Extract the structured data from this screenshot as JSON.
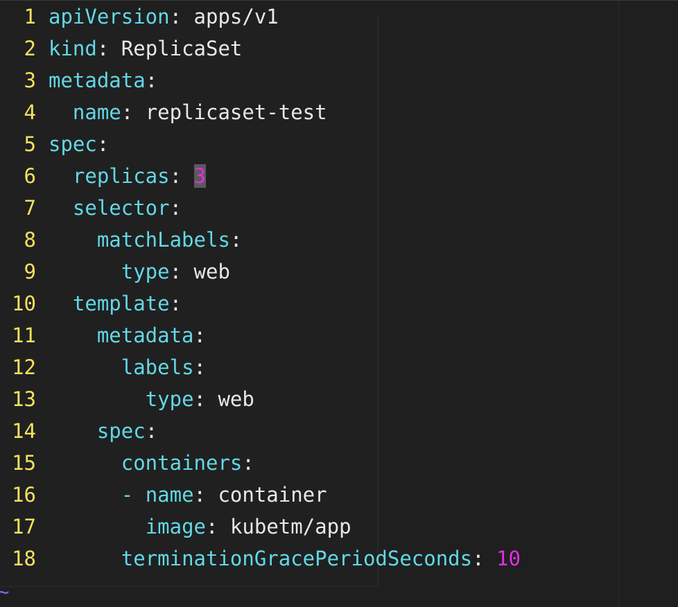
{
  "editor": {
    "lines": [
      {
        "n": "1",
        "indent": "",
        "dash": "",
        "key": "apiVersion",
        "value": "apps/v1",
        "value_type": "string"
      },
      {
        "n": "2",
        "indent": "",
        "dash": "",
        "key": "kind",
        "value": "ReplicaSet",
        "value_type": "string"
      },
      {
        "n": "3",
        "indent": "",
        "dash": "",
        "key": "metadata",
        "value": "",
        "value_type": "string"
      },
      {
        "n": "4",
        "indent": "  ",
        "dash": "",
        "key": "name",
        "value": "replicaset-test",
        "value_type": "string"
      },
      {
        "n": "5",
        "indent": "",
        "dash": "",
        "key": "spec",
        "value": "",
        "value_type": "string"
      },
      {
        "n": "6",
        "indent": "  ",
        "dash": "",
        "key": "replicas",
        "value": "3",
        "value_type": "number",
        "cursor": true
      },
      {
        "n": "7",
        "indent": "  ",
        "dash": "",
        "key": "selector",
        "value": "",
        "value_type": "string"
      },
      {
        "n": "8",
        "indent": "    ",
        "dash": "",
        "key": "matchLabels",
        "value": "",
        "value_type": "string"
      },
      {
        "n": "9",
        "indent": "      ",
        "dash": "",
        "key": "type",
        "value": "web",
        "value_type": "string"
      },
      {
        "n": "10",
        "indent": "  ",
        "dash": "",
        "key": "template",
        "value": "",
        "value_type": "string"
      },
      {
        "n": "11",
        "indent": "    ",
        "dash": "",
        "key": "metadata",
        "value": "",
        "value_type": "string"
      },
      {
        "n": "12",
        "indent": "      ",
        "dash": "",
        "key": "labels",
        "value": "",
        "value_type": "string"
      },
      {
        "n": "13",
        "indent": "        ",
        "dash": "",
        "key": "type",
        "value": "web",
        "value_type": "string"
      },
      {
        "n": "14",
        "indent": "    ",
        "dash": "",
        "key": "spec",
        "value": "",
        "value_type": "string"
      },
      {
        "n": "15",
        "indent": "      ",
        "dash": "",
        "key": "containers",
        "value": "",
        "value_type": "string"
      },
      {
        "n": "16",
        "indent": "      ",
        "dash": "- ",
        "key": "name",
        "value": "container",
        "value_type": "string"
      },
      {
        "n": "17",
        "indent": "        ",
        "dash": "",
        "key": "image",
        "value": "kubetm/app",
        "value_type": "string"
      },
      {
        "n": "18",
        "indent": "      ",
        "dash": "",
        "key": "terminationGracePeriodSeconds",
        "value": "10",
        "value_type": "number"
      }
    ],
    "empty_line_marker": "~"
  },
  "colors": {
    "background": "#1f1f1f",
    "line_number": "#f1e25f",
    "key": "#62d8e6",
    "text": "#e8e8e8",
    "number": "#e02ee4",
    "cursor_bg": "#5a5a5a",
    "tilde": "#6f6ff0"
  }
}
